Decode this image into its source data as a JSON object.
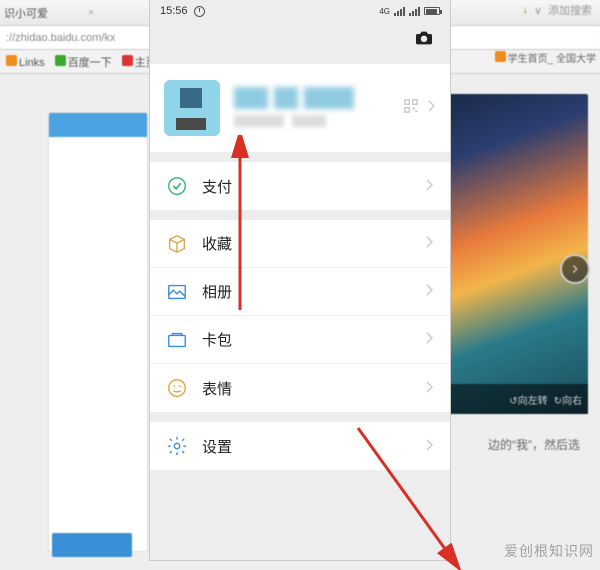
{
  "status": {
    "time": "15:56",
    "signal_label": "4G"
  },
  "browser": {
    "tab_title": "识小可爱",
    "url": "://zhidao.baidu.com/kx",
    "bookmarks": [
      "Links",
      "百度一下",
      "主页"
    ],
    "top_right_action": "添加搜索",
    "right_bookmarks": "学生首页_  全国大学",
    "slideshow": {
      "prev": "向左转",
      "next": "向右"
    },
    "instruction_fragment": "边的“我”，然后选"
  },
  "profile": {
    "qr_label": "qr-code",
    "chevron_label": "open-profile"
  },
  "menu": {
    "pay": "支付",
    "favorites": "收藏",
    "album": "相册",
    "cards": "卡包",
    "stickers": "表情",
    "settings": "设置"
  },
  "watermark": "爱创根知识网",
  "colors": {
    "pay": "#33b76e",
    "favorites": "#d9a84e",
    "album": "#3a8be0",
    "cards": "#3a8be0",
    "stickers": "#e9a13c",
    "settings": "#3a8be0",
    "arrow": "#d93025"
  }
}
